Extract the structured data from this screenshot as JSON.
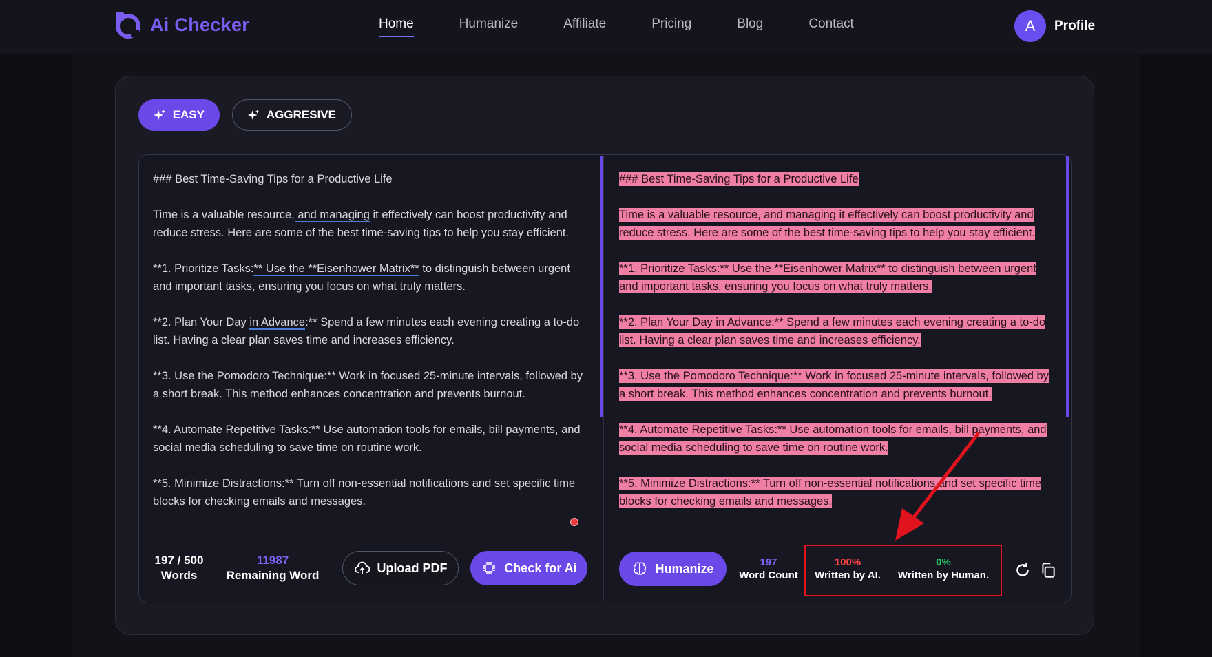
{
  "brand": {
    "name": "Ai Checker"
  },
  "nav": {
    "items": [
      {
        "label": "Home",
        "active": true
      },
      {
        "label": "Humanize"
      },
      {
        "label": "Affiliate"
      },
      {
        "label": "Pricing"
      },
      {
        "label": "Blog"
      },
      {
        "label": "Contact"
      }
    ]
  },
  "profile": {
    "initial": "A",
    "label": "Profile"
  },
  "modes": {
    "easy": "EASY",
    "aggressive": "AGGRESIVE"
  },
  "input_text": {
    "heading": "### Best Time-Saving Tips for a Productive Life",
    "p1_a": "Time is a valuable resource,",
    "p1_b": " and managing",
    "p1_c": " it effectively can boost productivity and reduce stress. Here are some of the best time-saving tips to help you stay efficient.",
    "p2_a": "**1. Prioritize Tasks:",
    "p2_b": "** Use the **Eisenhower Matrix**",
    "p2_c": " to distinguish between urgent and important tasks, ensuring you focus on what truly matters.",
    "p3_a": "**2. Plan Your Day ",
    "p3_b": "in Advance",
    "p3_c": ":** Spend a few minutes each evening creating a to-do list. Having a clear plan saves time and increases efficiency.",
    "p4": "**3. Use the Pomodoro Technique:** Work in focused 25-minute intervals, followed by a short break. This method enhances concentration and prevents burnout.",
    "p5": "**4. Automate Repetitive Tasks:** Use automation tools for emails, bill payments, and social media scheduling to save time on routine work.",
    "p6": "**5. Minimize Distractions:** Turn off non-essential notifications and set specific time blocks for checking emails and messages."
  },
  "output_text": {
    "heading": "### Best Time-Saving Tips for a Productive Life",
    "p1_hl": "Time is a valuable resource, and managing it effectively can boost productivity and reduce stress.",
    "p1_hl2": " Here are some of the best time-saving tips to help you stay efficient.",
    "p2": "**1. Prioritize Tasks:** Use the **Eisenhower Matrix** to distinguish between urgent and important tasks, ensuring you focus on what truly matters.",
    "p3_a": "**2. Plan Your Day in Advance:** Spend a few minutes each evening creating a to-do list.",
    "p3_b": " Having a clear plan saves time and increases efficiency.",
    "p4_a": "**3. Use the Pomodoro Technique:** Work in focused 25-minute intervals, followed by a short break.",
    "p4_b": " This method enhances concentration and prevents burnout.",
    "p5": "**4. Automate Repetitive Tasks:** Use automation tools for emails, bill payments, and social media scheduling to save time on routine work.",
    "p6": "**5. Minimize Distractions:** Turn off non-essential notifications and set specific time blocks for checking emails and messages."
  },
  "left_bar": {
    "words_count": "197 / 500",
    "words_label": "Words",
    "remaining_count": "11987",
    "remaining_label": "Remaining Word",
    "upload_label": "Upload PDF",
    "check_label": "Check for Ai"
  },
  "right_bar": {
    "humanize_label": "Humanize",
    "word_count": "197",
    "word_count_label": "Word Count",
    "ai_percent": "100%",
    "ai_label": "Written by AI.",
    "human_percent": "0%",
    "human_label": "Written by Human."
  },
  "colors": {
    "accent": "#6b48e8",
    "highlight": "#f07fa6",
    "ai_red": "#ff4545",
    "human_green": "#22c55e",
    "callout_red": "#e0141f"
  }
}
